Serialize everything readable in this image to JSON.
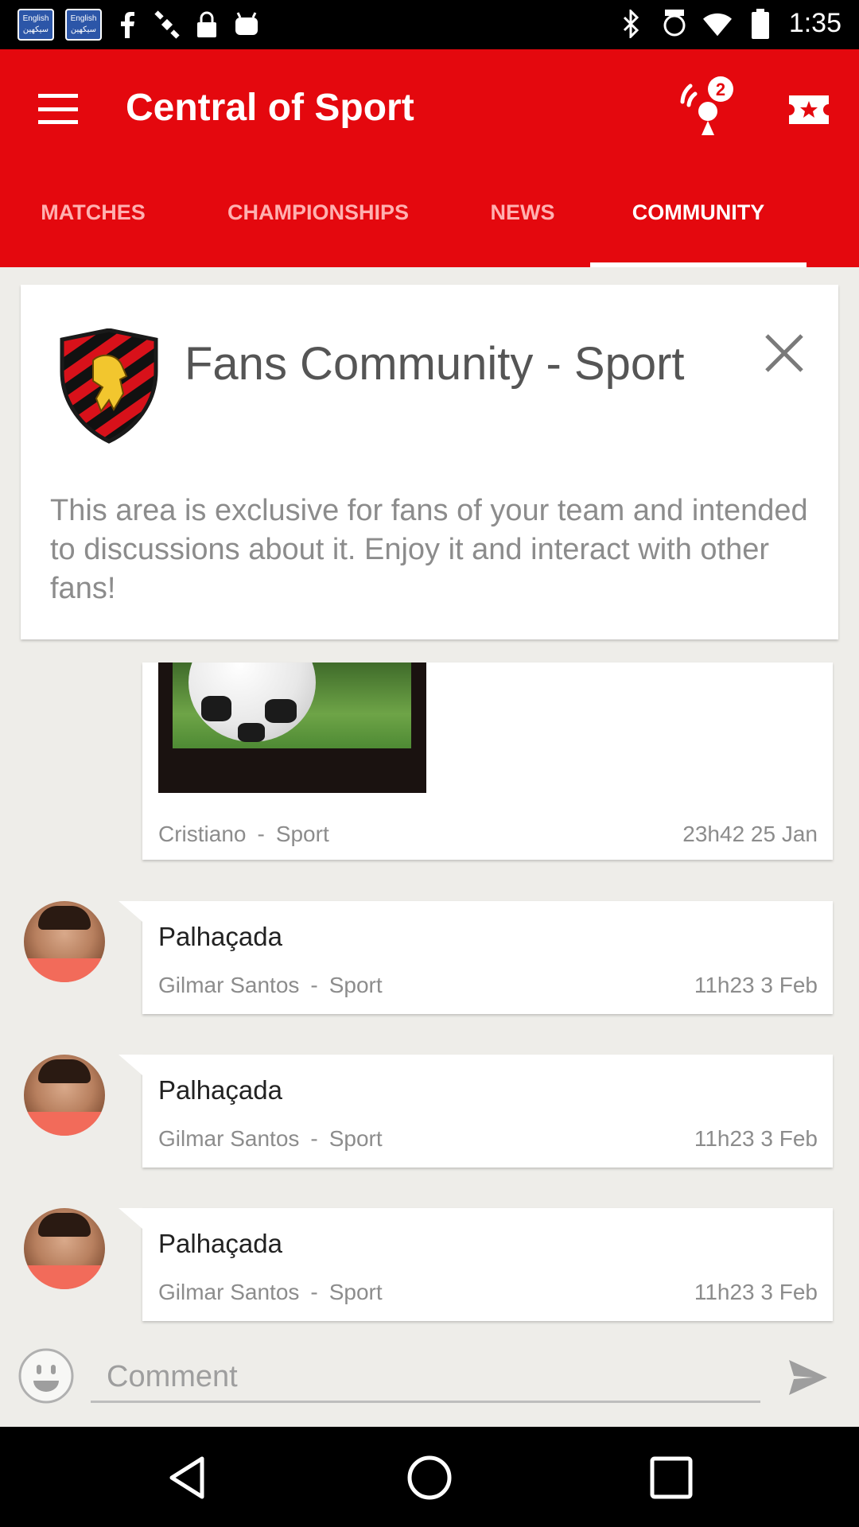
{
  "status_bar": {
    "keyboard_badges": [
      {
        "top": "English",
        "bottom": "سيكهين"
      },
      {
        "top": "English",
        "bottom": "سيكهين"
      }
    ],
    "icons": [
      "facebook-icon",
      "satellite-icon",
      "lock-icon",
      "android-icon",
      "bluetooth-icon",
      "fake-gps-icon",
      "wifi-icon",
      "battery-icon"
    ],
    "time": "1:35"
  },
  "app_bar": {
    "title": "Central of Sport",
    "notification_count": "2",
    "accent_color": "#e4080e"
  },
  "tabs": [
    {
      "label": "MATCHES",
      "active": false
    },
    {
      "label": "CHAMPIONSHIPS",
      "active": false
    },
    {
      "label": "NEWS",
      "active": false
    },
    {
      "label": "COMMUNITY",
      "active": true
    }
  ],
  "info_card": {
    "title": "Fans Community - Sport",
    "description": "This area is exclusive for fans of your team and intended to discussions about it. Enjoy it and interact with other fans!"
  },
  "posts": [
    {
      "title": "",
      "author": "Cristiano",
      "team": "Sport",
      "time": "23h42 25 Jan",
      "has_image": true
    },
    {
      "title": "Palhaçada",
      "author": "Gilmar Santos",
      "team": "Sport",
      "time": "11h23 3 Feb",
      "has_image": false
    },
    {
      "title": "Palhaçada",
      "author": "Gilmar Santos",
      "team": "Sport",
      "time": "11h23 3 Feb",
      "has_image": false
    },
    {
      "title": "Palhaçada",
      "author": "Gilmar Santos",
      "team": "Sport",
      "time": "11h23 3 Feb",
      "has_image": false
    }
  ],
  "meta_separator": "-",
  "comment": {
    "placeholder": "Comment",
    "value": ""
  }
}
